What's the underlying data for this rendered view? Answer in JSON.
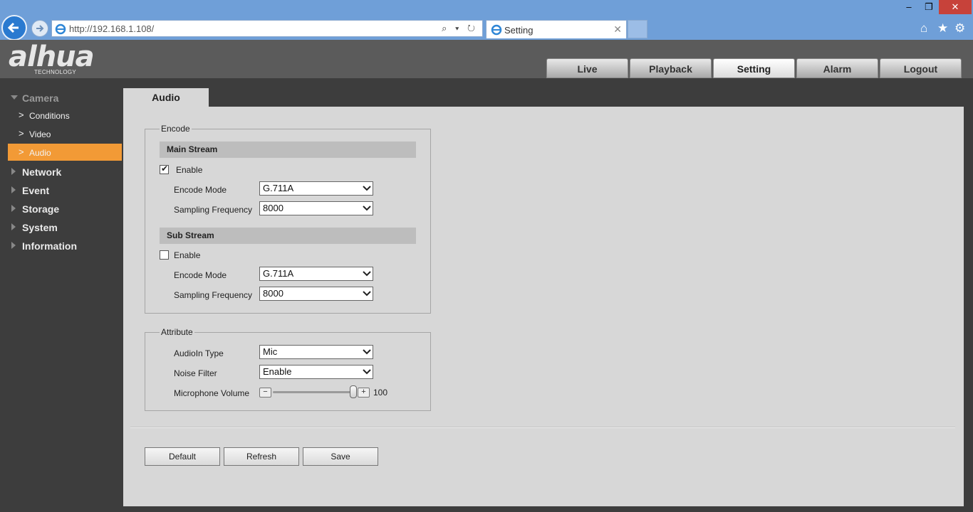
{
  "browser": {
    "url": "http://192.168.1.108/",
    "tab_title": "Setting"
  },
  "header": {
    "logo_text": "alhua",
    "logo_sub": "TECHNOLOGY",
    "tabs": [
      {
        "label": "Live"
      },
      {
        "label": "Playback"
      },
      {
        "label": "Setting"
      },
      {
        "label": "Alarm"
      },
      {
        "label": "Logout"
      }
    ],
    "active_tab": "Setting"
  },
  "sidebar": {
    "camera": "Camera",
    "sub_items": [
      {
        "label": "Conditions"
      },
      {
        "label": "Video"
      },
      {
        "label": "Audio"
      }
    ],
    "items": [
      {
        "label": "Network"
      },
      {
        "label": "Event"
      },
      {
        "label": "Storage"
      },
      {
        "label": "System"
      },
      {
        "label": "Information"
      }
    ]
  },
  "content": {
    "tab": "Audio",
    "encode": {
      "legend": "Encode",
      "main_stream": {
        "title": "Main Stream",
        "enable_label": "Enable",
        "enabled": true,
        "encode_mode_label": "Encode Mode",
        "encode_mode": "G.711A",
        "sampling_label": "Sampling Frequency",
        "sampling": "8000"
      },
      "sub_stream": {
        "title": "Sub Stream",
        "enable_label": "Enable",
        "enabled": false,
        "encode_mode_label": "Encode Mode",
        "encode_mode": "G.711A",
        "sampling_label": "Sampling Frequency",
        "sampling": "8000"
      }
    },
    "attribute": {
      "legend": "Attribute",
      "audioin_label": "AudioIn Type",
      "audioin": "Mic",
      "noise_label": "Noise Filter",
      "noise": "Enable",
      "volume_label": "Microphone Volume",
      "volume": "100",
      "volume_fraction": 1.0
    },
    "buttons": {
      "default": "Default",
      "refresh": "Refresh",
      "save": "Save"
    }
  }
}
